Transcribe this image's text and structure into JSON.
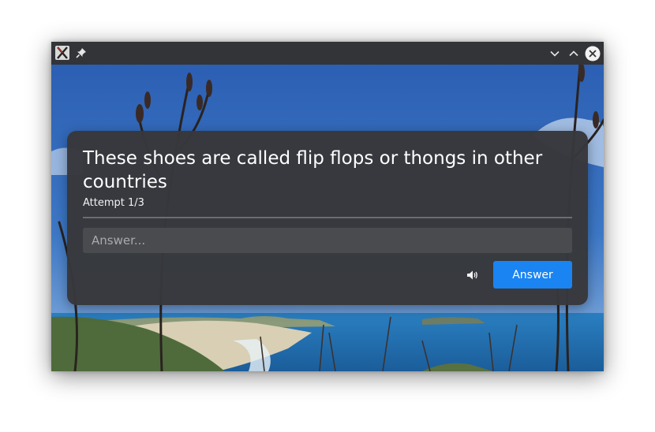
{
  "window": {
    "app_icon": "x-app-icon",
    "pin_icon": "pin-icon",
    "controls": {
      "minimize_icon": "chevron-down-icon",
      "maximize_icon": "chevron-up-icon",
      "close_icon": "close-icon"
    }
  },
  "quiz": {
    "question": "These shoes are called flip flops or thongs in other countries",
    "attempt": "Attempt 1/3",
    "answer_placeholder": "Answer...",
    "answer_value": "",
    "speaker_icon": "speaker-icon",
    "answer_button_label": "Answer"
  },
  "colors": {
    "accent": "#1a84f2",
    "dialog_bg": "#37383c",
    "input_bg": "#4a4b4f",
    "titlebar_bg": "#323438"
  }
}
